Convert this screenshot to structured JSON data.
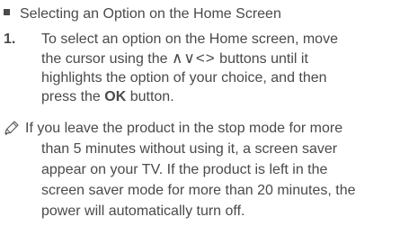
{
  "heading": {
    "text": "Selecting an Option on the Home Screen"
  },
  "step": {
    "number": "1.",
    "line1": "To select an option on the Home screen, move",
    "line2_prefix": "the cursor using the ",
    "arrows": "∧∨<>",
    "line2_suffix": " buttons until it",
    "line3": "highlights the option of your choice, and then",
    "line4_prefix": "press the ",
    "ok_label": "OK",
    "line4_suffix": " button."
  },
  "note": {
    "icon": "pencil-note-icon",
    "line1": "If you leave the product in the stop mode for more",
    "line2": "than 5 minutes without using it, a screen saver",
    "line3": "appear on your TV. If the product is left in the",
    "line4": "screen saver mode for more than 20 minutes, the",
    "line5": "power will automatically turn off."
  }
}
